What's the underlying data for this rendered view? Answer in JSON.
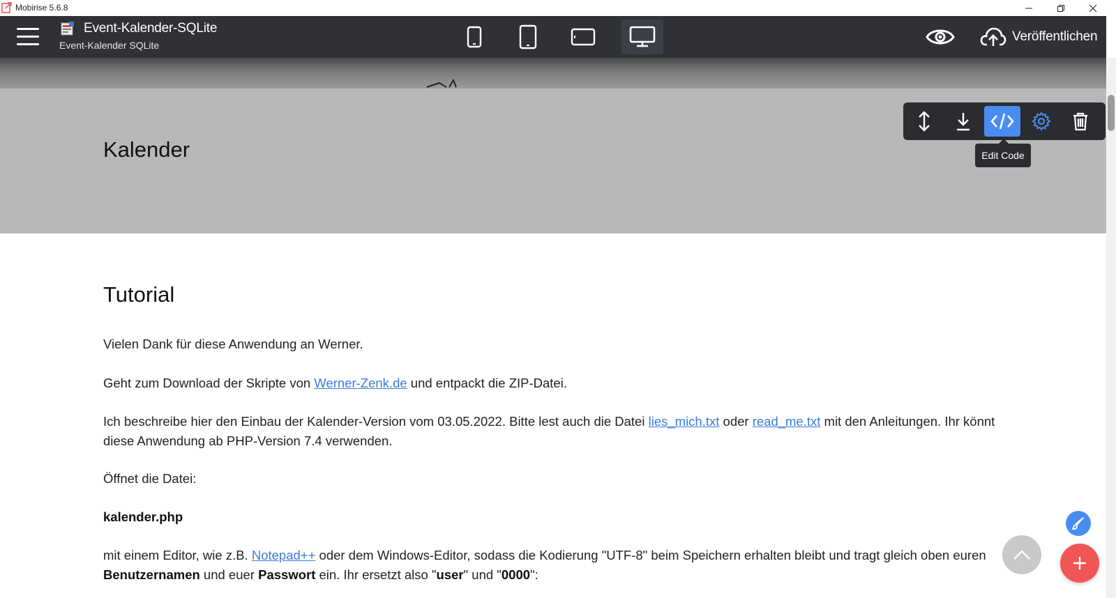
{
  "window": {
    "title": "Mobirise 5.6.8"
  },
  "topbar": {
    "project_title": "Event-Kalender-SQLite",
    "project_subtitle": "Event-Kalender SQLite",
    "devices": [
      "phone-portrait",
      "tablet-portrait",
      "tablet-landscape",
      "desktop"
    ],
    "active_device": "desktop",
    "publish_label": "Veröffentlichen"
  },
  "block_toolbar": {
    "buttons": [
      "move-icon",
      "download-icon",
      "code-icon",
      "gear-icon",
      "trash-icon"
    ],
    "active_button": "code-icon",
    "tooltip": "Edit Code"
  },
  "sections": {
    "kalender_heading": "Kalender",
    "tutorial_heading": "Tutorial",
    "p1": "Vielen Dank für diese Anwendung an Werner.",
    "p2": {
      "before": "Geht zum Download der Skripte von ",
      "link": "Werner-Zenk.de",
      "after": " und entpackt die ZIP-Datei."
    },
    "p3": {
      "before": "Ich beschreibe hier den Einbau der Kalender-Version vom 03.05.2022. Bitte lest auch die Datei ",
      "link1": "lies_mich.txt",
      "middle": " oder ",
      "link2": "read_me.txt",
      "after": " mit den Anleitungen. Ihr könnt diese Anwendung ab PHP-Version 7.4 verwenden."
    },
    "p4": "Öffnet die Datei:",
    "p5": "kalender.php",
    "p6": {
      "part1": "mit einem Editor, wie z.B. ",
      "link": "Notepad++",
      "part2": " oder dem Windows-Editor, sodass die Kodierung \"UTF-8\" beim Speichern erhalten bleibt und tragt gleich oben euren ",
      "bold1": "Benutzernamen",
      "part3": " und euer ",
      "bold2": "Passwort",
      "part4": " ein. Ihr ersetzt also \"",
      "bold3": "user",
      "part5": "\" und \"",
      "bold4": "0000",
      "part6": "\":"
    }
  },
  "colors": {
    "topbar": "#2f3136",
    "accent_blue": "#4a8cf0",
    "fab_red": "#f25555",
    "link": "#3b7bd8",
    "grey_section": "#b8b8b8"
  }
}
